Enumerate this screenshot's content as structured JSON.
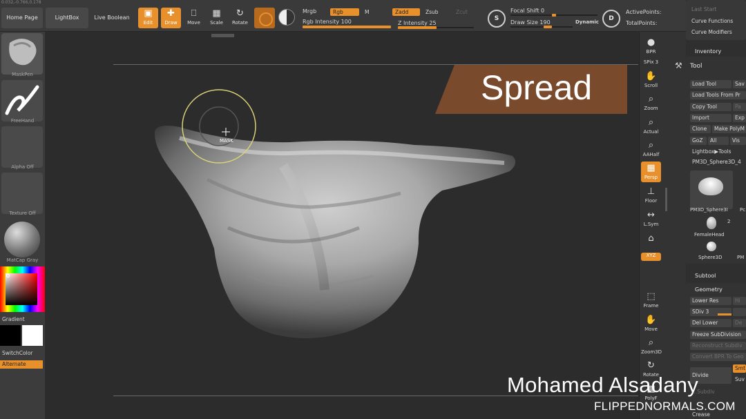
{
  "topbar": {
    "coords": "0.032,-0.766,0.178",
    "home_page": "Home Page",
    "lightbox": "LightBox",
    "live_boolean": "Live Boolean",
    "tools": [
      {
        "label": "Edit",
        "icon": "edit-icon",
        "active": true
      },
      {
        "label": "Draw",
        "icon": "draw-icon",
        "active": true
      },
      {
        "label": "Move",
        "icon": "move-icon",
        "active": false
      },
      {
        "label": "Scale",
        "icon": "scale-icon",
        "active": false
      },
      {
        "label": "Rotate",
        "icon": "rotate-icon",
        "active": false
      }
    ],
    "mrgb": "Mrgb",
    "rgb": "Rgb",
    "m": "M",
    "zadd": "Zadd",
    "zsub": "Zsub",
    "zcut": "Zcut",
    "rgb_intensity": "Rgb Intensity 100",
    "z_intensity": "Z Intensity 25",
    "focal_shift": "Focal Shift 0",
    "draw_size": "Draw Size 190",
    "dynamic": "Dynamic",
    "active_points": "ActivePoints:",
    "total_points": "TotalPoints:",
    "s_icon": "S",
    "d_icon": "D",
    "rgb_intensity_value": 100,
    "z_intensity_value": 25,
    "focal_shift_value": 0,
    "draw_size_value": 190
  },
  "left": {
    "brush": "MaskPen",
    "stroke": "FreeHand",
    "alpha": "Alpha Off",
    "texture": "Texture Off",
    "material": "MatCap Gray",
    "gradient": "Gradient",
    "switch_color": "SwitchColor",
    "alternate": "Alternate"
  },
  "viewport": {
    "banner": "Spread",
    "cursor_label": "MASK"
  },
  "strip": [
    {
      "label": "BPR",
      "icon": "bpr-icon",
      "on": false
    },
    {
      "label": "SPix 3",
      "icon": "spix-icon",
      "on": false
    },
    {
      "label": "Scroll",
      "icon": "scroll-icon",
      "on": false
    },
    {
      "label": "Zoom",
      "icon": "zoom-icon",
      "on": false
    },
    {
      "label": "Actual",
      "icon": "actual-icon",
      "on": false
    },
    {
      "label": "AAHalf",
      "icon": "aahalf-icon",
      "on": false
    },
    {
      "label": "Persp",
      "icon": "persp-icon",
      "on": true
    },
    {
      "label": "Floor",
      "icon": "floor-icon",
      "on": false
    },
    {
      "label": "L.Sym",
      "icon": "lsym-icon",
      "on": false
    },
    {
      "label": "",
      "icon": "lock-icon",
      "on": false
    },
    {
      "label": "XYZ",
      "icon": "xyz-icon",
      "on": true
    },
    {
      "label": "Frame",
      "icon": "frame-icon",
      "on": false
    },
    {
      "label": "Move",
      "icon": "move-icon",
      "on": false
    },
    {
      "label": "Zoom3D",
      "icon": "zoom3d-icon",
      "on": false
    },
    {
      "label": "Rotate",
      "icon": "rotate-icon",
      "on": false
    },
    {
      "label": "PolyF",
      "icon": "polyf-icon",
      "on": false
    }
  ],
  "right": {
    "last_start": "Last Start",
    "curve_functions": "Curve Functions",
    "curve_modifiers": "Curve Modifiers",
    "inventory": "Inventory",
    "tool": "Tool",
    "load_tool": "Load Tool",
    "save": "Sav",
    "load_tools_from": "Load Tools From Pr",
    "copy_tool": "Copy Tool",
    "paste": "Pa",
    "import": "Import",
    "export": "Exp",
    "clone": "Clone",
    "make_poly": "Make PolyM",
    "goz": "GoZ",
    "all": "All",
    "visible": "Vis",
    "lightbox_tools": "Lightbox▶Tools",
    "current_tool": "PM3D_Sphere3D_4",
    "tool_thumb": "PM3D_Sphere3I",
    "tool_thumb_b": "Pc",
    "female_head": "FemaleHead",
    "female_count": "2",
    "sphere3d": "Sphere3D",
    "pm": "PM",
    "subtool": "Subtool",
    "geometry": "Geometry",
    "lower_res": "Lower Res",
    "higher": "Hi",
    "sdiv": "SDiv 3",
    "sdiv_value": 3,
    "del_lower": "Del Lower",
    "del_higher": "De",
    "freeze_subdivision": "Freeze SubDivision",
    "reconstruct_subdiv": "Reconstruct Subdiv",
    "convert_bpr": "Convert BPR To Geo",
    "divide": "Divide",
    "smt": "Smt",
    "suv": "Suv",
    "reconstruct_subdiv2": "...Subdiv",
    "crease": "Crease"
  },
  "watermark": {
    "author": "Mohamed Alsadany",
    "site": "FLIPPEDNORMALS.COM"
  },
  "colors": {
    "accent": "#e8902c",
    "banner": "#7a4a2c",
    "bg": "#2a2a2a"
  }
}
